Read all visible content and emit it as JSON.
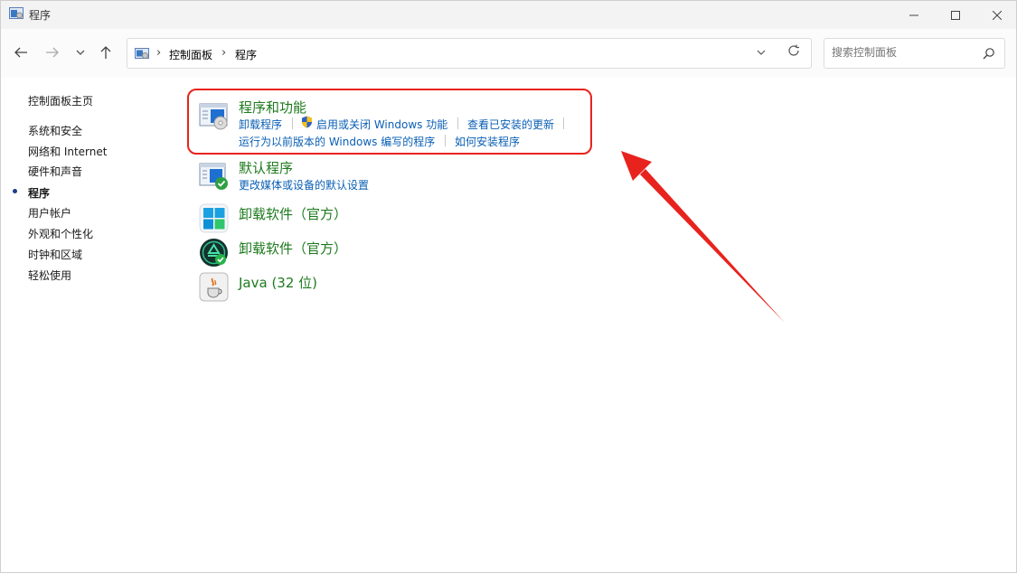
{
  "window": {
    "title": "程序",
    "controls": [
      "minimize",
      "maximize",
      "close"
    ]
  },
  "nav": {
    "back": "back-arrow-icon",
    "forward": "forward-arrow-icon",
    "recent": "chevron-down-icon",
    "up": "up-arrow-icon"
  },
  "address": {
    "crumbs": [
      "控制面板",
      "程序"
    ]
  },
  "search": {
    "placeholder": "搜索控制面板"
  },
  "sidebar": {
    "items": [
      {
        "label": "控制面板主页"
      },
      {
        "label": "系统和安全"
      },
      {
        "label": "网络和 Internet"
      },
      {
        "label": "硬件和声音"
      },
      {
        "label": "程序",
        "active": true
      },
      {
        "label": "用户帐户"
      },
      {
        "label": "外观和个性化"
      },
      {
        "label": "时钟和区域"
      },
      {
        "label": "轻松使用"
      }
    ]
  },
  "categories": [
    {
      "title": "程序和功能",
      "icon": "programs-features-icon",
      "links": [
        "卸载程序",
        "启用或关闭 Windows 功能",
        "查看已安装的更新",
        "运行为以前版本的 Windows 编写的程序",
        "如何安装程序"
      ]
    },
    {
      "title": "默认程序",
      "icon": "default-programs-icon",
      "links": [
        "更改媒体或设备的默认设置"
      ]
    },
    {
      "title": "卸载软件（官方）",
      "icon": "windows-logo-icon",
      "links": []
    },
    {
      "title": "卸载软件（官方）",
      "icon": "recycle-icon",
      "links": []
    },
    {
      "title": "Java (32 位)",
      "icon": "java-icon",
      "links": []
    }
  ],
  "colors": {
    "category_title": "#1e7a1e",
    "link": "#0a5fb4",
    "annotation": "#e8231d"
  }
}
